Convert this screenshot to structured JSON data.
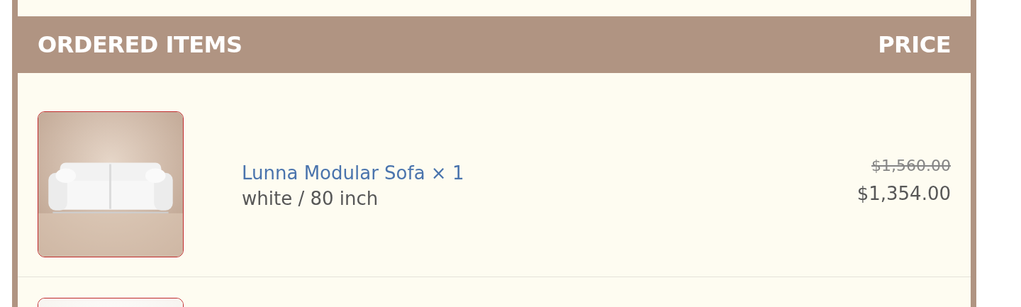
{
  "header": {
    "items_label": "ORDERED ITEMS",
    "price_label": "PRICE"
  },
  "items": [
    {
      "image": {
        "kind": "picture"
      },
      "name": "Lunna Modular Sofa × 1",
      "variant": "white / 80 inch",
      "original_price": "$1,560.00",
      "price": "$1,354.00"
    },
    {
      "image": {
        "kind": "picture"
      }
    }
  ]
}
